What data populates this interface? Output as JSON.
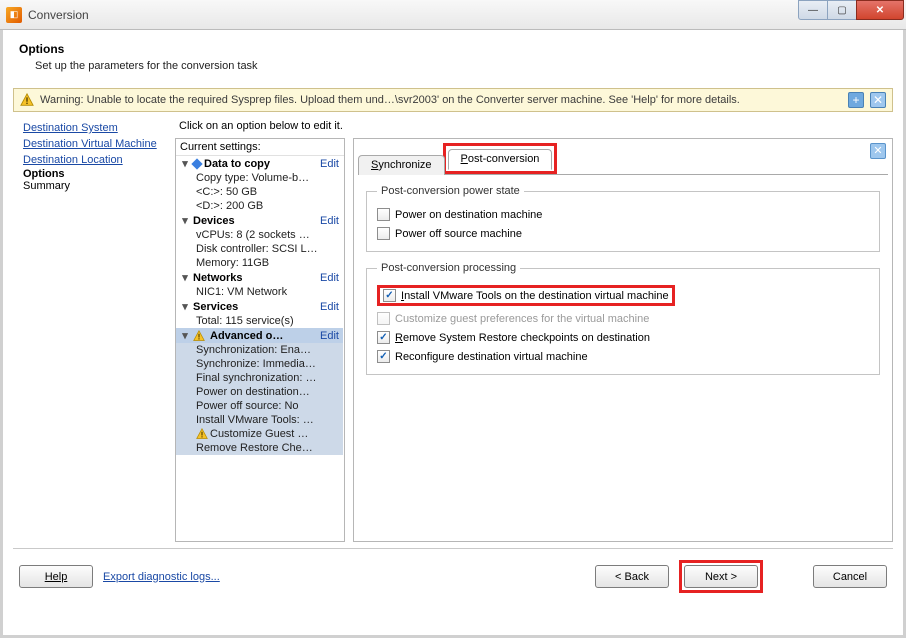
{
  "window": {
    "title": "Conversion"
  },
  "header": {
    "title": "Options",
    "subtitle": "Set up the parameters for the conversion task"
  },
  "warning": {
    "text": "Warning: Unable to locate the required Sysprep files. Upload them und…\\svr2003' on the Converter server machine. See 'Help' for more details."
  },
  "steps": {
    "dest_system": "Destination System",
    "dest_vm": "Destination Virtual Machine",
    "dest_loc": "Destination Location",
    "options": "Options",
    "summary": "Summary"
  },
  "instruction": "Click on an option below to edit it.",
  "settings": {
    "header": "Current settings:",
    "edit": "Edit",
    "groups": {
      "data": {
        "label": "Data to copy",
        "items": [
          "Copy type: Volume-b…",
          "<C:>: 50 GB",
          "<D:>: 200 GB"
        ]
      },
      "devices": {
        "label": "Devices",
        "items": [
          "vCPUs: 8 (2 sockets …",
          "Disk controller: SCSI L…",
          "Memory: 11GB"
        ]
      },
      "networks": {
        "label": "Networks",
        "items": [
          "NIC1: VM Network"
        ]
      },
      "services": {
        "label": "Services",
        "items": [
          "Total: 115 service(s)"
        ]
      },
      "advanced": {
        "label": "Advanced o…",
        "items": [
          "Synchronization: Ena…",
          "Synchronize: Immedia…",
          "Final synchronization: …",
          "Power on destination…",
          "Power off source: No",
          "Install VMware Tools: …",
          "Customize Guest …",
          "Remove Restore Che…"
        ]
      }
    }
  },
  "tabs": {
    "sync_pre": "S",
    "sync_rest": "ynchronize",
    "post_pre": "P",
    "post_rest": "ost-conversion"
  },
  "fieldsets": {
    "power": {
      "legend": "Post-conversion power state",
      "power_on": "Power on destination machine",
      "power_off": "Power off source machine"
    },
    "processing": {
      "legend": "Post-conversion processing",
      "install_pre": "I",
      "install_rest": "nstall VMware Tools on the destination virtual machine",
      "customize": "Customize guest preferences for the virtual machine",
      "remove_pre": "R",
      "remove_rest": "emove System Restore checkpoints on destination",
      "reconf": "Reconfigure destination virtual machine"
    }
  },
  "footer": {
    "help": "Help",
    "diag": "Export diagnostic logs...",
    "back": "< Back",
    "next": "Next >",
    "cancel": "Cancel"
  }
}
